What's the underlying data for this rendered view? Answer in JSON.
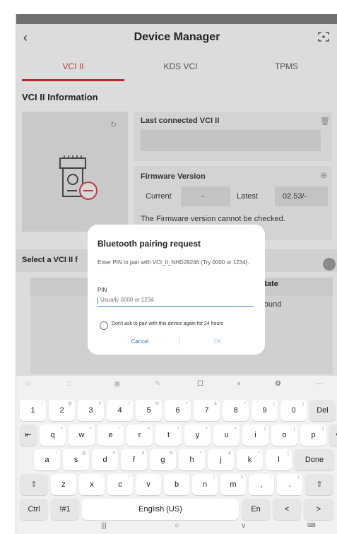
{
  "header": {
    "title": "Device Manager",
    "back_icon": "back-chevron-icon",
    "scan_icon": "scan-icon"
  },
  "tabs": [
    {
      "label": "VCI II",
      "active": true
    },
    {
      "label": "KDS VCI",
      "active": false
    },
    {
      "label": "TPMS",
      "active": false
    }
  ],
  "vci_info": {
    "section_title": "VCI II Information",
    "last_connected_label": "Last connected VCI II",
    "firmware_label": "Firmware Version",
    "current_label": "Current",
    "current_value": "-",
    "latest_label": "Latest",
    "latest_value": "02.53/-",
    "firmware_note": "The Firmware version cannot be checked."
  },
  "select_section": {
    "label": "Select a VCI II f",
    "state_header": "State",
    "state_value": "Found"
  },
  "dialog": {
    "title": "Bluetooth pairing request",
    "message": "Enter PIN to pair with VCI_II_NHD29246 (Try 0000 or 1234).",
    "pin_label": "PIN",
    "pin_placeholder": "Usually 0000 or 1234",
    "checkbox_label": "Don't ask to pair with this device again for 24 hours",
    "cancel_label": "Cancel",
    "ok_label": "OK"
  },
  "keyboard": {
    "row1": [
      {
        "k": "1",
        "s": "~"
      },
      {
        "k": "2",
        "s": "@"
      },
      {
        "k": "3",
        "s": "#"
      },
      {
        "k": "4",
        "s": "/"
      },
      {
        "k": "5",
        "s": "%"
      },
      {
        "k": "6",
        "s": "^"
      },
      {
        "k": "7",
        "s": "&"
      },
      {
        "k": "8",
        "s": "*"
      },
      {
        "k": "9",
        "s": "("
      },
      {
        "k": "0",
        "s": ")"
      }
    ],
    "del_label": "Del",
    "row2": [
      {
        "k": "q",
        "s": "+"
      },
      {
        "k": "w",
        "s": "×"
      },
      {
        "k": "e",
        "s": "÷"
      },
      {
        "k": "r",
        "s": "="
      },
      {
        "k": "t",
        "s": "\\"
      },
      {
        "k": "y",
        "s": "<"
      },
      {
        "k": "u",
        "s": ">"
      },
      {
        "k": "i",
        "s": "["
      },
      {
        "k": "o",
        "s": "]"
      },
      {
        "k": "p",
        "s": "{"
      }
    ],
    "row3": [
      {
        "k": "a",
        "s": "!"
      },
      {
        "k": "s",
        "s": "@"
      },
      {
        "k": "d",
        "s": "#"
      },
      {
        "k": "f",
        "s": "$"
      },
      {
        "k": "g",
        "s": "%"
      },
      {
        "k": "h",
        "s": "^"
      },
      {
        "k": "j",
        "s": "&"
      },
      {
        "k": "k",
        "s": "*"
      },
      {
        "k": "l",
        "s": "("
      }
    ],
    "done_label": "Done",
    "row4": [
      {
        "k": "z",
        "s": "-"
      },
      {
        "k": "x",
        "s": "'"
      },
      {
        "k": "c",
        "s": "\""
      },
      {
        "k": "v",
        "s": ":"
      },
      {
        "k": "b",
        "s": ";"
      },
      {
        "k": "n",
        "s": "/"
      },
      {
        "k": "m",
        "s": "?"
      },
      {
        "k": ",",
        "s": "!"
      },
      {
        "k": ".",
        "s": "?"
      }
    ],
    "ctrl_label": "Ctrl",
    "sym_label": "!#1",
    "space_label": "English (US)",
    "lang_label": "En"
  },
  "colors": {
    "accent": "#b82a2a",
    "link": "#3a6fc9"
  }
}
